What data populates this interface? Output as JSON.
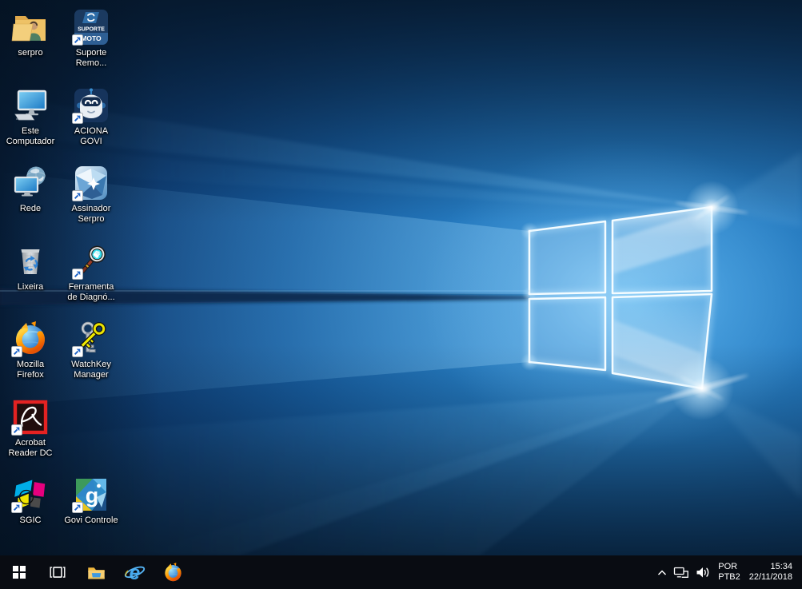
{
  "desktop": {
    "icons": [
      {
        "label": "serpro",
        "icon": "user-folder-icon",
        "shortcut": false
      },
      {
        "label": "Suporte\nRemo...",
        "icon": "suporte-remoto-icon",
        "shortcut": true
      },
      {
        "label": "Este\nComputador",
        "icon": "this-pc-icon",
        "shortcut": false
      },
      {
        "label": "ACIONA\nGOVI",
        "icon": "aciona-govi-robot-icon",
        "shortcut": true
      },
      {
        "label": "Rede",
        "icon": "network-places-icon",
        "shortcut": false
      },
      {
        "label": "Assinador\nSerpro",
        "icon": "assinador-serpro-gem-icon",
        "shortcut": true
      },
      {
        "label": "Lixeira",
        "icon": "recycle-bin-icon",
        "shortcut": false
      },
      {
        "label": "Ferramenta\nde Diagnó...",
        "icon": "diagnostic-tool-magnifier-icon",
        "shortcut": true
      },
      {
        "label": "Mozilla\nFirefox",
        "icon": "firefox-icon",
        "shortcut": true
      },
      {
        "label": "WatchKey\nManager",
        "icon": "watchkey-keys-icon",
        "shortcut": true
      },
      {
        "label": "Acrobat\nReader DC",
        "icon": "acrobat-reader-icon",
        "shortcut": true
      },
      {
        "label": "SGIC",
        "icon": "sgic-cmyk-icon",
        "shortcut": true
      },
      {
        "label": "Govi Controle",
        "icon": "govi-controle-mosaic-icon",
        "shortcut": true
      }
    ],
    "icon_text": {
      "suporte_line1": "SUPORTE",
      "suporte_line2": "MOTO",
      "govi_letter": "g"
    }
  },
  "taskbar": {
    "start": {
      "icon": "windows-start-icon"
    },
    "buttons": [
      {
        "icon": "task-view-icon"
      },
      {
        "icon": "file-explorer-icon"
      },
      {
        "icon": "internet-explorer-icon",
        "letter": "e"
      },
      {
        "icon": "firefox-icon"
      }
    ],
    "tray": {
      "chevron_icon": "chevron-up-icon",
      "network_icon": "wired-network-icon",
      "volume_icon": "volume-speaker-icon",
      "language_line1": "POR",
      "language_line2": "PTB2",
      "time": "15:34",
      "date": "22/11/2018"
    }
  },
  "colors": {
    "wallpaper_accent": "#2e86c8",
    "taskbar_bg": "#090c12",
    "label_text": "#ffffff"
  }
}
